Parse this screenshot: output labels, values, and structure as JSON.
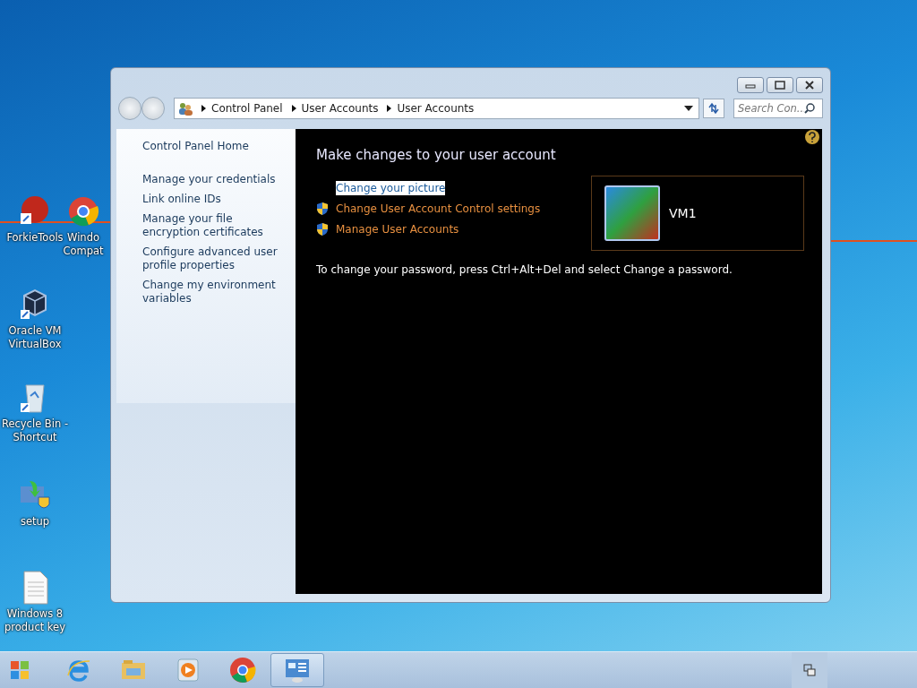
{
  "desktop_icons": [
    {
      "label": "ForkieTools",
      "kind": "app"
    },
    {
      "label": "Windo Compat",
      "kind": "chrome"
    },
    {
      "label": "Oracle VM VirtualBox",
      "kind": "virtualbox"
    },
    {
      "label": "Recycle Bin - Shortcut",
      "kind": "recycle"
    },
    {
      "label": "setup",
      "kind": "setup"
    },
    {
      "label": "Windows 8 product key",
      "kind": "textfile"
    }
  ],
  "address_bar": {
    "breadcrumb": [
      "Control Panel",
      "User Accounts",
      "User Accounts"
    ]
  },
  "search": {
    "placeholder": "Search Con..."
  },
  "sidebar": {
    "items": [
      "Control Panel Home",
      "Manage your credentials",
      "Link online IDs",
      "Manage your file encryption certificates",
      "Configure advanced user profile properties",
      "Change my environment variables"
    ]
  },
  "main": {
    "heading": "Make changes to your user account",
    "links": [
      {
        "label": "Change your picture",
        "kind": "plain",
        "selected": true
      },
      {
        "label": "Change User Account Control settings",
        "kind": "shield",
        "selected": false
      },
      {
        "label": "Manage User Accounts",
        "kind": "shield",
        "selected": false
      }
    ],
    "note": "To change your password, press Ctrl+Alt+Del and select Change a password."
  },
  "account": {
    "name": "VM1"
  },
  "taskbar": {
    "items": [
      {
        "kind": "ie",
        "selected": false
      },
      {
        "kind": "explorer",
        "selected": false
      },
      {
        "kind": "media",
        "selected": false
      },
      {
        "kind": "chrome",
        "selected": false
      },
      {
        "kind": "controlpanel",
        "selected": true
      }
    ]
  }
}
